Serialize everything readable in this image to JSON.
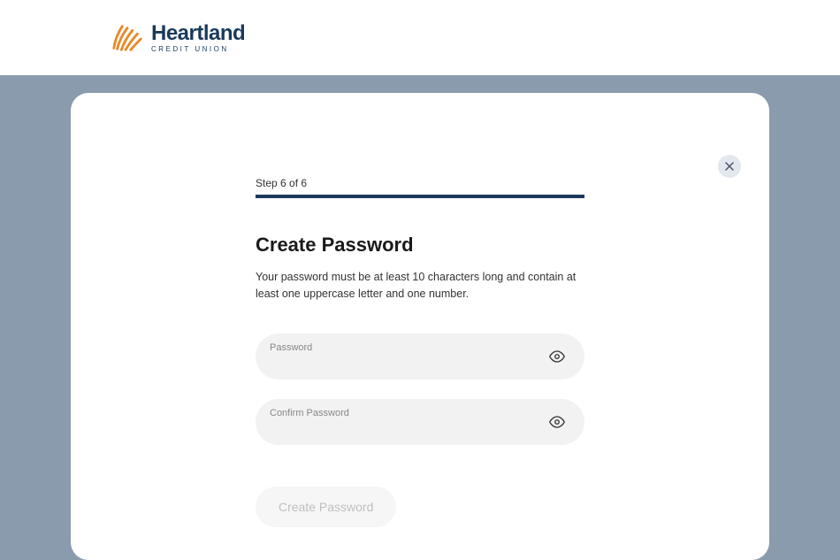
{
  "header": {
    "brand_main": "Heartland",
    "brand_sub": "CREDIT UNION"
  },
  "form": {
    "step_label": "Step 6 of 6",
    "title": "Create Password",
    "description": "Your password must be at least 10 characters long and contain at least one uppercase letter and one number.",
    "password_label": "Password",
    "confirm_label": "Confirm Password",
    "submit_label": "Create Password"
  }
}
